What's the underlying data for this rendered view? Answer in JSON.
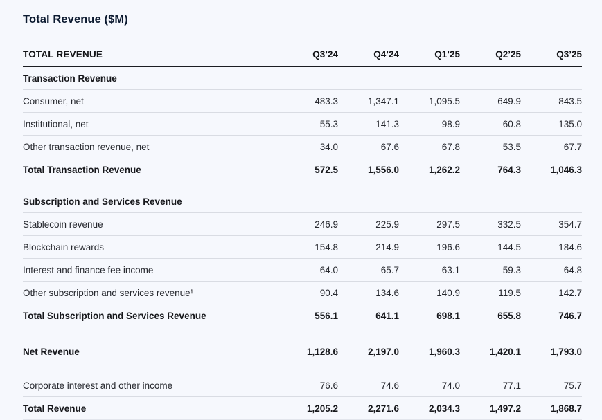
{
  "page": {
    "background": "#f6f8fd",
    "accent_title_color": "#0c1a30",
    "thick_rule_color": "#1b1d22",
    "thin_rule_color": "#d9dce3"
  },
  "title": "Total Revenue ($M)",
  "table": {
    "header": {
      "label": "TOTAL REVENUE",
      "columns": [
        "Q3’24",
        "Q4’24",
        "Q1’25",
        "Q2’25",
        "Q3’25"
      ]
    },
    "rows": [
      {
        "type": "section",
        "label": "Transaction Revenue",
        "values": [],
        "border": "thin"
      },
      {
        "type": "item",
        "label": "Consumer, net",
        "values": [
          "483.3",
          "1,347.1",
          "1,095.5",
          "649.9",
          "843.5"
        ],
        "border": "thin"
      },
      {
        "type": "item",
        "label": "Institutional, net",
        "values": [
          "55.3",
          "141.3",
          "98.9",
          "60.8",
          "135.0"
        ],
        "border": "thin"
      },
      {
        "type": "item",
        "label": "Other transaction revenue, net",
        "values": [
          "34.0",
          "67.6",
          "67.8",
          "53.5",
          "67.7"
        ],
        "border": "mid"
      },
      {
        "type": "total",
        "label": "Total Transaction Revenue",
        "values": [
          "572.5",
          "1,556.0",
          "1,262.2",
          "764.3",
          "1,046.3"
        ]
      },
      {
        "type": "spacer",
        "height": 14
      },
      {
        "type": "section",
        "label": "Subscription and Services Revenue",
        "values": [],
        "border": "thin"
      },
      {
        "type": "item",
        "label": "Stablecoin revenue",
        "values": [
          "246.9",
          "225.9",
          "297.5",
          "332.5",
          "354.7"
        ],
        "border": "thin"
      },
      {
        "type": "item",
        "label": "Blockchain rewards",
        "values": [
          "154.8",
          "214.9",
          "196.6",
          "144.5",
          "184.6"
        ],
        "border": "thin"
      },
      {
        "type": "item",
        "label": "Interest and finance fee income",
        "values": [
          "64.0",
          "65.7",
          "63.1",
          "59.3",
          "64.8"
        ],
        "border": "thin"
      },
      {
        "type": "item",
        "label": "Other subscription and services revenue¹",
        "values": [
          "90.4",
          "134.6",
          "140.9",
          "119.5",
          "142.7"
        ],
        "border": "mid"
      },
      {
        "type": "total",
        "label": "Total Subscription and Services Revenue",
        "values": [
          "556.1",
          "641.1",
          "698.1",
          "655.8",
          "746.7"
        ]
      },
      {
        "type": "spacer",
        "height": 20
      },
      {
        "type": "total",
        "label": "Net Revenue",
        "values": [
          "1,128.6",
          "2,197.0",
          "1,960.3",
          "1,420.1",
          "1,793.0"
        ]
      },
      {
        "type": "spacer",
        "height": 16,
        "border": "mid"
      },
      {
        "type": "item",
        "label": "Corporate interest and other income",
        "values": [
          "76.6",
          "74.6",
          "74.0",
          "77.1",
          "75.7"
        ],
        "border": "thin"
      },
      {
        "type": "total",
        "label": "Total Revenue",
        "values": [
          "1,205.2",
          "2,271.6",
          "2,034.3",
          "1,497.2",
          "1,868.7"
        ],
        "border": "light"
      }
    ]
  },
  "chart_data": {
    "type": "table",
    "title": "Total Revenue ($M)",
    "categories": [
      "Q3'24",
      "Q4'24",
      "Q1'25",
      "Q2'25",
      "Q3'25"
    ],
    "series": [
      {
        "name": "Consumer, net",
        "values": [
          483.3,
          1347.1,
          1095.5,
          649.9,
          843.5
        ]
      },
      {
        "name": "Institutional, net",
        "values": [
          55.3,
          141.3,
          98.9,
          60.8,
          135.0
        ]
      },
      {
        "name": "Other transaction revenue, net",
        "values": [
          34.0,
          67.6,
          67.8,
          53.5,
          67.7
        ]
      },
      {
        "name": "Total Transaction Revenue",
        "values": [
          572.5,
          1556.0,
          1262.2,
          764.3,
          1046.3
        ]
      },
      {
        "name": "Stablecoin revenue",
        "values": [
          246.9,
          225.9,
          297.5,
          332.5,
          354.7
        ]
      },
      {
        "name": "Blockchain rewards",
        "values": [
          154.8,
          214.9,
          196.6,
          144.5,
          184.6
        ]
      },
      {
        "name": "Interest and finance fee income",
        "values": [
          64.0,
          65.7,
          63.1,
          59.3,
          64.8
        ]
      },
      {
        "name": "Other subscription and services revenue",
        "values": [
          90.4,
          134.6,
          140.9,
          119.5,
          142.7
        ]
      },
      {
        "name": "Total Subscription and Services Revenue",
        "values": [
          556.1,
          641.1,
          698.1,
          655.8,
          746.7
        ]
      },
      {
        "name": "Net Revenue",
        "values": [
          1128.6,
          2197.0,
          1960.3,
          1420.1,
          1793.0
        ]
      },
      {
        "name": "Corporate interest and other income",
        "values": [
          76.6,
          74.6,
          74.0,
          77.1,
          75.7
        ]
      },
      {
        "name": "Total Revenue",
        "values": [
          1205.2,
          2271.6,
          2034.3,
          1497.2,
          1868.7
        ]
      }
    ]
  }
}
